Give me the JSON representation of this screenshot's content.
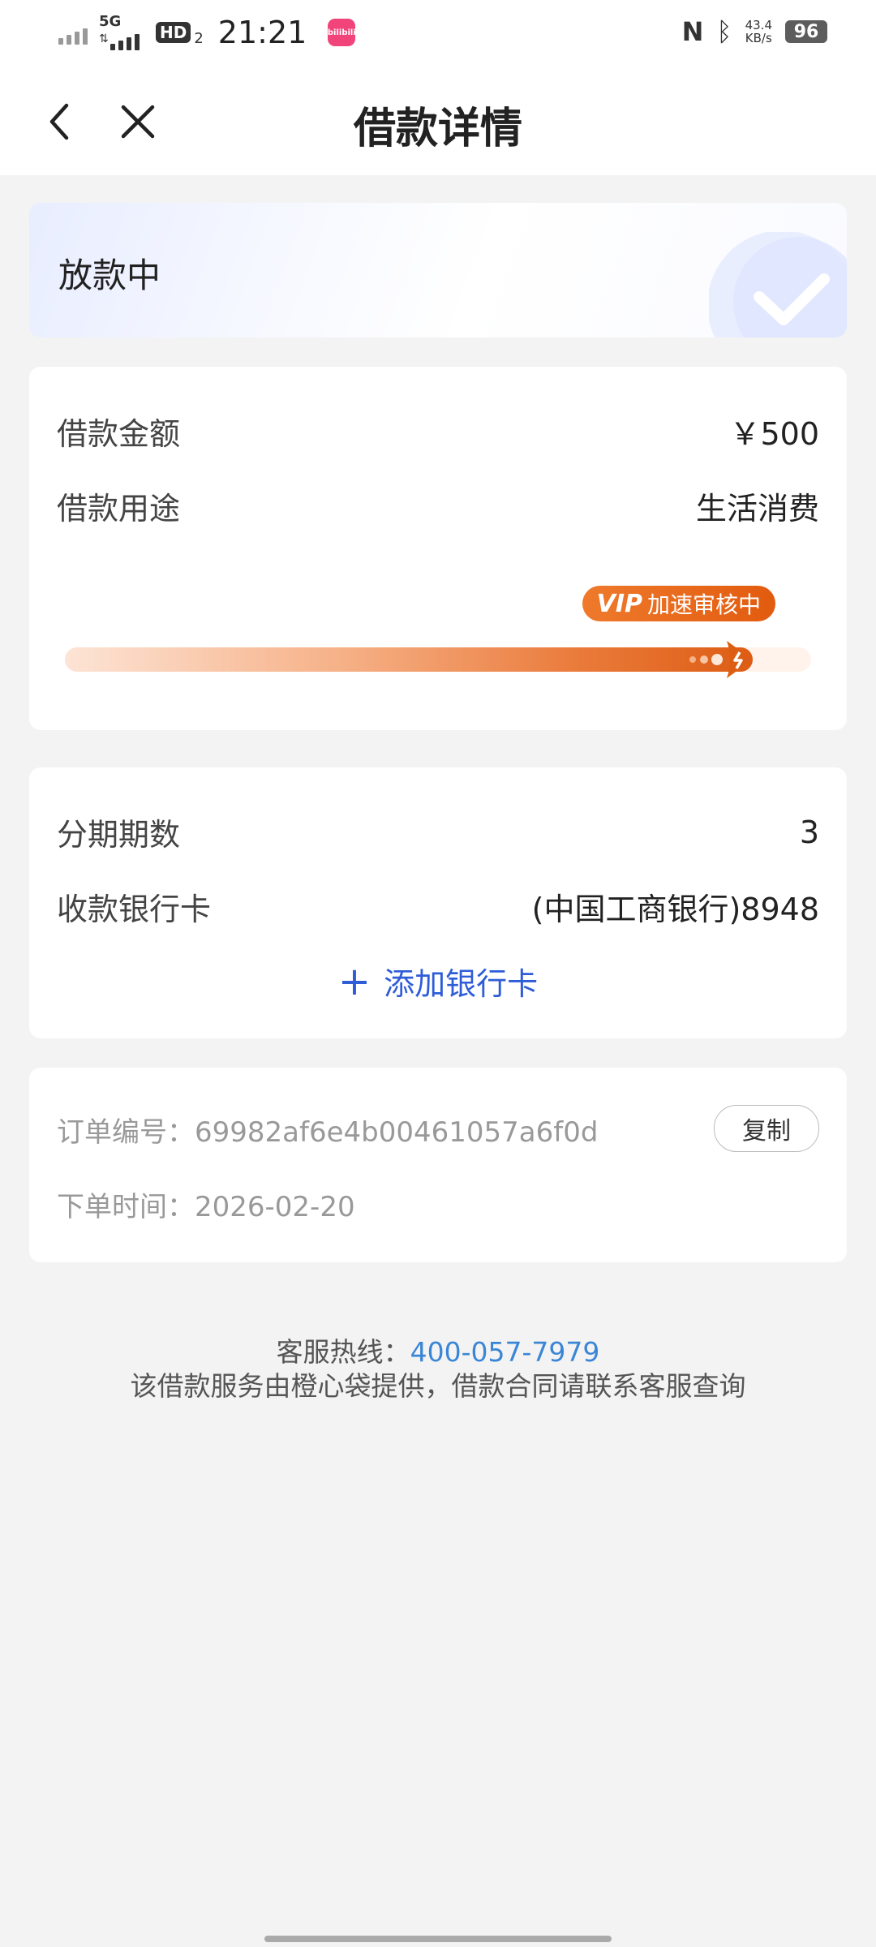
{
  "status_bar": {
    "network": "5G",
    "hd_label": "HD",
    "hd_sub": "2",
    "time": "21:21",
    "app_icon_label": "bilibili",
    "nfc": "N",
    "speed_value": "43.4",
    "speed_unit": "KB/s",
    "battery": "96"
  },
  "header": {
    "title": "借款详情"
  },
  "status_card": {
    "status": "放款中"
  },
  "loan": {
    "amount_label": "借款金额",
    "amount_value": "￥500",
    "purpose_label": "借款用途",
    "purpose_value": "生活消费",
    "vip_mark": "VIP",
    "vip_text": "加速审核中",
    "progress": 0.96
  },
  "bank": {
    "installments_label": "分期期数",
    "installments_value": "3",
    "card_label": "收款银行卡",
    "card_value": "(中国工商银行)8948",
    "add_card_label": "添加银行卡"
  },
  "order": {
    "number_label": "订单编号：",
    "number_value": "69982af6e4b00461057a6f0d",
    "copy_label": "复制",
    "time_label": "下单时间：",
    "time_value": "2026-02-20"
  },
  "footer": {
    "hotline_label": "客服热线：",
    "hotline_number": "400-057-7979",
    "note": "该借款服务由橙心袋提供，借款合同请联系客服查询"
  },
  "colors": {
    "accent_blue": "#2f5dd8",
    "hotline_blue": "#3a86d6",
    "progress_orange": "#dd5d14"
  }
}
